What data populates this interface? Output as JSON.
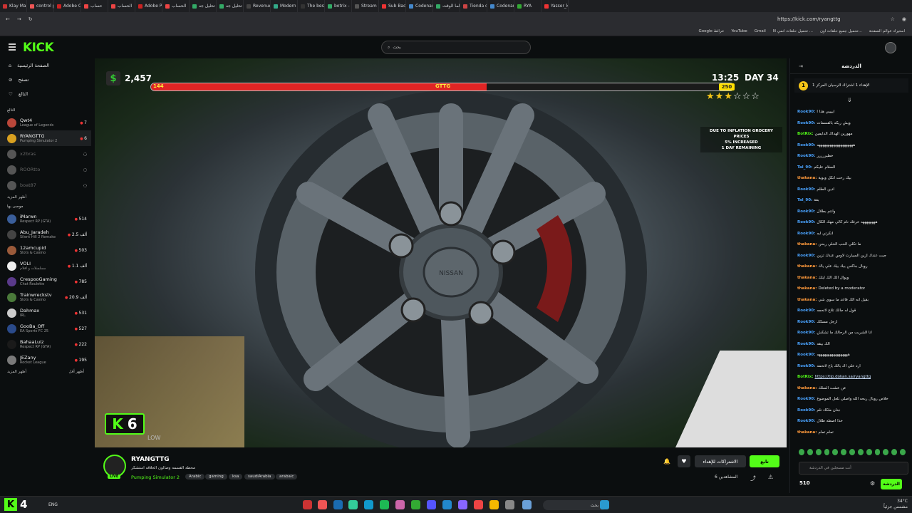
{
  "browser": {
    "tabs": [
      "Klay Mar",
      "control p",
      "Adobe C",
      "حساب",
      "الحساب",
      "Adobe P",
      "الحساب",
      "تحليل جه",
      "تحليل جه",
      "Revenue",
      "Modern",
      "The best",
      "botrix -",
      "Stream C",
      "Sub Back",
      "Codenam",
      "لما الوقت",
      "Tienda d",
      "Codenam",
      "RYA",
      "Yasser_k"
    ],
    "url": "https://kick.com/ryangttg",
    "bookmarks": [
      "Google خرائط",
      "YouTube",
      "Gmail",
      "N تحميل حلقات انمي ...",
      "تحميل جميع حلقات اون...",
      "استيراد عوالم الصفحة"
    ]
  },
  "header": {
    "logo": "KICK",
    "search_placeholder": "بحث"
  },
  "sidebar": {
    "nav": [
      {
        "label": "الصفحة الرئيسية",
        "icon": "home-icon"
      },
      {
        "label": "تصفح",
        "icon": "browse-icon"
      },
      {
        "label": "التالع",
        "icon": "heart-icon"
      }
    ],
    "following_header": "التالع",
    "following": [
      {
        "name": "Qwt4",
        "game": "League of Legends",
        "viewers": "7",
        "color": "#b9473a",
        "live": true
      },
      {
        "name": "RYANGTTG",
        "game": "Pumping Simulator 2",
        "viewers": "6",
        "color": "#d8a020",
        "live": true,
        "active": true
      },
      {
        "name": "x2bras",
        "game": "",
        "viewers": "",
        "color": "#555",
        "live": false
      },
      {
        "name": "ROORtto",
        "game": "",
        "viewers": "",
        "color": "#555",
        "live": false
      },
      {
        "name": "boat87",
        "game": "",
        "viewers": "",
        "color": "#555",
        "live": false
      }
    ],
    "show_more_1": "أظهر المزيد",
    "recommended_header": "موصى بها",
    "recommended": [
      {
        "name": "iMarwn",
        "game": "Respect RP (GTA)",
        "viewers": "514",
        "color": "#3a5e9a"
      },
      {
        "name": "Abu_Jaradeh",
        "game": "Silent Hill 2 Remake",
        "viewers": "2.5 ألف",
        "color": "#444"
      },
      {
        "name": "12amcupid",
        "game": "Slots & Casino",
        "viewers": "503",
        "color": "#9a5a3a"
      },
      {
        "name": "VOLI",
        "game": "مسلسلات و افلام",
        "viewers": "1.1 ألف",
        "color": "#eee"
      },
      {
        "name": "CrespooGaming",
        "game": "Chat Roulette",
        "viewers": "785",
        "color": "#5a3a8a"
      },
      {
        "name": "Trainwreckstv",
        "game": "Slots & Casino",
        "viewers": "20.9 ألف",
        "color": "#4a7a3a"
      },
      {
        "name": "Dahmax",
        "game": "IRL",
        "viewers": "531",
        "color": "#ccc"
      },
      {
        "name": "GooBa_Off",
        "game": "EA Sports FC 25",
        "viewers": "527",
        "color": "#2a4a8a"
      },
      {
        "name": "BahaaLuiz",
        "game": "Respect RP (GTA)",
        "viewers": "222",
        "color": "#1a1a1a"
      },
      {
        "name": "JEZany",
        "game": "Rocket League",
        "viewers": "195",
        "color": "#7a7a7a"
      }
    ],
    "show_more_2": "أظهر المزيد",
    "show_less": "أظهر أقل"
  },
  "video": {
    "money": "2,457",
    "bar_min": "144",
    "bar_name": "GTTG",
    "bar_max": "250",
    "bar_progress": 0.576,
    "time": "13:25",
    "day": "DAY 34",
    "stars_filled": 3,
    "stars_total": 6,
    "notice_lines": [
      "DUE TO INFLATION GROCERY PRICES",
      "5% INCREASED",
      "1 DAY REMAINING"
    ],
    "badge_letter": "K",
    "badge_num": "6",
    "quality": "LOW",
    "hub_text": "NISSAN"
  },
  "stream": {
    "name": "RYANGTTG",
    "title": "محطه القسمه وصالون الحلاقه استشكر",
    "game": "Pumping Simulator 2",
    "tags": [
      "Arabic",
      "gaming",
      "ksa",
      "saudiArabia",
      "arabaic"
    ],
    "live_label": "LIVE",
    "follow_label": "تابع",
    "subscribe_label": "الاشتراكات للإهداء",
    "viewers_label": "المشاهدين 6"
  },
  "chat": {
    "title": "الدردشة",
    "pinned": "الإهداء 1 اشتراك الرسيان المركز 1",
    "pinned_num": "1",
    "messages": [
      {
        "user": "Rook90",
        "color": "blue",
        "text": "اييييي هذا ا"
      },
      {
        "user": "Rook90",
        "color": "blue",
        "text": "ويش ريكه بالقسمات"
      },
      {
        "user": "BotRix",
        "color": "green",
        "text": "مهورين الهداك الدايمين"
      },
      {
        "user": "Rook90",
        "color": "blue",
        "text": "ههههههههههههههههههههه"
      },
      {
        "user": "Rook90",
        "color": "blue",
        "text": "خطيررررر"
      },
      {
        "user": "Tal_90",
        "color": "blue",
        "text": "السلام عليكم"
      },
      {
        "user": "thakana",
        "color": "orange",
        "text": "بيك رحت انكل ويوية"
      },
      {
        "user": "Rook90",
        "color": "blue",
        "text": "ادين الطلم"
      },
      {
        "user": "Tal_90",
        "color": "blue",
        "text": "بقة"
      },
      {
        "user": "Rook90",
        "color": "blue",
        "text": "وانتم بطلال"
      },
      {
        "user": "Rook90",
        "color": "blue",
        "text": "ههههههههه خرفك نام كالي مهك الكال"
      },
      {
        "user": "Rook90",
        "color": "blue",
        "text": "انكرتي ايه"
      },
      {
        "user": "thakana",
        "color": "orange",
        "text": "ما تكلي الحب الخلي ربحن"
      },
      {
        "user": "Rook90",
        "color": "blue",
        "text": "جبت عندك ازين السيارت لاوس عندك تزين"
      },
      {
        "user": "thakana",
        "color": "orange",
        "text": "روبال جاكس بيك بيك علي ياك"
      },
      {
        "user": "thakana",
        "color": "orange",
        "text": "ويوال الك الك ايتك"
      },
      {
        "user": "thakana",
        "color": "orange",
        "text": "Deleted by a moderator"
      },
      {
        "user": "thakana",
        "color": "orange",
        "text": "بقيل انه الك قاعد ما سوي شي"
      },
      {
        "user": "Rook90",
        "color": "blue",
        "text": "قول له جالك تلاع لاتحمه"
      },
      {
        "user": "Rook90",
        "color": "blue",
        "text": "ارجل مسكك"
      },
      {
        "user": "Rook90",
        "color": "blue",
        "text": "انا الشريت من الرحالك ما تشكش"
      },
      {
        "user": "Rook90",
        "color": "blue",
        "text": "الك بيقه"
      },
      {
        "user": "Rook90",
        "color": "blue",
        "text": "هههههههههههههههههه"
      },
      {
        "user": "Rook90",
        "color": "blue",
        "text": "ارد علي اك بالك ياع لاتحمه"
      },
      {
        "user": "BotRix",
        "color": "green",
        "text": "https://tip.dokan.sa/ryangttg"
      },
      {
        "user": "thakana",
        "color": "orange",
        "text": "عن عشت السلك"
      },
      {
        "user": "Rook90",
        "color": "blue",
        "text": "خلاص روبال ربحه الله واصلي تلعل الموضوع"
      },
      {
        "user": "Rook90",
        "color": "blue",
        "text": "جنان ملكاد نلم"
      },
      {
        "user": "Rook90",
        "color": "blue",
        "text": "خذا اصطه طلال"
      },
      {
        "user": "thakana",
        "color": "orange",
        "text": "تمام تمام"
      }
    ],
    "input_placeholder": "أنت مسجلين في الدردشة",
    "points": "510",
    "send_label": "الدردشة"
  },
  "taskbar": {
    "badge": "K",
    "count": "4",
    "lang": "ENG",
    "search": "بحث",
    "temp": "34°C",
    "clock_note": "مشمس جزئياً"
  },
  "colors": {
    "brand": "#53fc18",
    "bg": "#0b0e0f",
    "hud_bar": "#e02424"
  }
}
